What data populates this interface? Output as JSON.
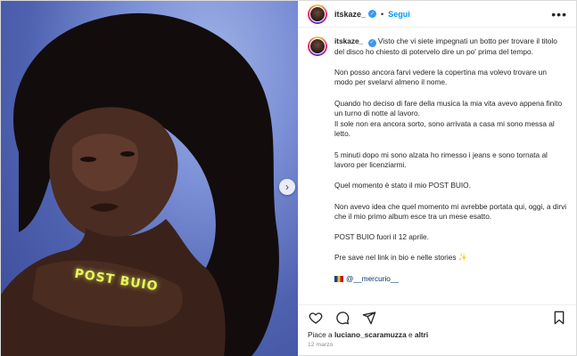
{
  "photo": {
    "overlay_text": "POST BUIO",
    "next_icon": "chevron-right-icon"
  },
  "header": {
    "username": "itskaze_",
    "verified_icon": "verified-badge-icon",
    "separator": "•",
    "follow_label": "Segui",
    "more_label": "•••"
  },
  "caption": {
    "username": "itskaze_",
    "paragraphs": [
      "Visto che vi siete impegnati un botto per trovare il titolo del disco ho chiesto di potervelo dire un po' prima del tempo.",
      "Non posso ancora farvi vedere la copertina ma volevo trovare un modo per svelarvi almeno il nome.",
      "Quando ho deciso di fare della musica la mia vita avevo appena finito un turno di notte al lavoro.",
      "Il sole non era ancora sorto, sono arrivata a casa mi sono messa al letto.",
      "5 minuti dopo mi sono alzata ho rimesso i jeans e sono tornata al lavoro per licenziarmi.",
      "Quel momento è stato il mio POST BUIO.",
      "Non avevo idea che quel momento mi avrebbe portata qui, oggi, a dirvi che il mio primo album esce tra un mese esatto.",
      "POST BUIO fuori il 12 aprile.",
      "Pre save nel link in bio e nelle stories"
    ],
    "sparkle": "✨",
    "credit_mention": "@__mercurio__"
  },
  "actions": {
    "like_icon": "heart-icon",
    "comment_icon": "comment-icon",
    "share_icon": "share-icon",
    "save_icon": "bookmark-icon"
  },
  "likes": {
    "prefix": "Piace a",
    "user": "luciano_scaramuzza",
    "joiner": "e",
    "others": "altri"
  },
  "date": "12 marzo",
  "colors": {
    "accent": "#0095f6",
    "verified": "#3897f0",
    "text": "#262626",
    "muted": "#8e8e8e",
    "overlay_text": "#e8f45a"
  }
}
